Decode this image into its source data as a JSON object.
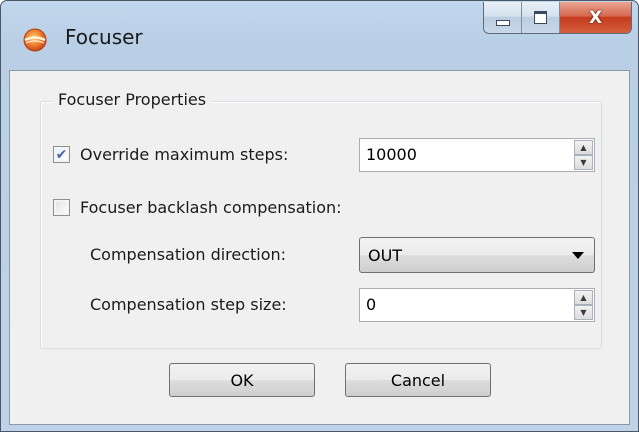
{
  "window": {
    "title": "Focuser",
    "minimize_icon": "minimize-icon",
    "maximize_icon": "maximize-icon",
    "close_glyph": "X"
  },
  "group": {
    "title": "Focuser Properties"
  },
  "override_steps": {
    "label": "Override maximum steps:",
    "checked": true,
    "check_glyph": "✔",
    "value": "10000"
  },
  "backlash": {
    "label": "Focuser backlash compensation:",
    "checked": false
  },
  "direction": {
    "label": "Compensation direction:",
    "value": "OUT"
  },
  "step_size": {
    "label": "Compensation step size:",
    "value": "0"
  },
  "spin_glyphs": {
    "up": "▲",
    "down": "▼"
  },
  "buttons": {
    "ok": "OK",
    "cancel": "Cancel"
  }
}
